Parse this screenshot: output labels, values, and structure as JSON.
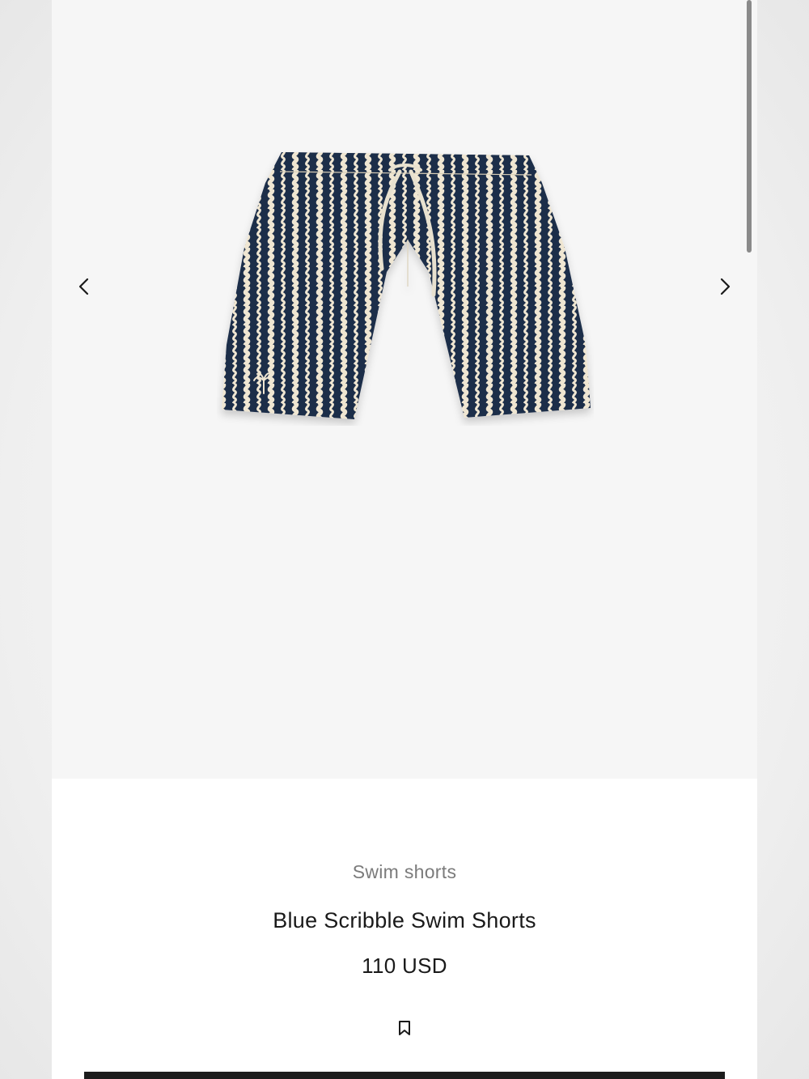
{
  "product": {
    "category": "Swim shorts",
    "title": "Blue Scribble Swim Shorts",
    "price": "110 USD"
  },
  "gallery": {
    "prev_icon": "chevron-left-icon",
    "next_icon": "chevron-right-icon"
  },
  "actions": {
    "bookmark_icon": "bookmark-icon"
  },
  "colors": {
    "navy": "#1f2f4a",
    "cream": "#efe6d2",
    "text_primary": "#1a1a1a",
    "text_secondary": "#7b7b7b",
    "gallery_bg": "#f6f6f6"
  }
}
